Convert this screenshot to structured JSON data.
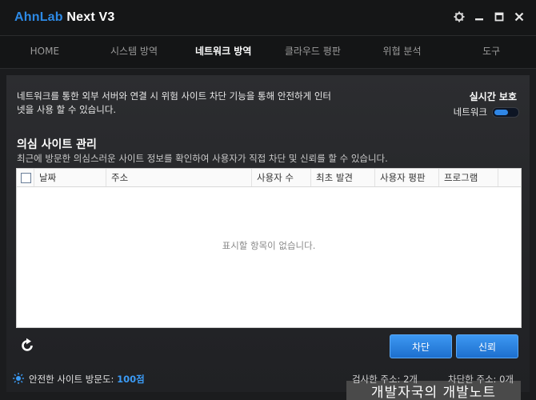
{
  "window": {
    "title_brand": "AhnLab",
    "title_product": " Next V3",
    "controls": {
      "settings": "gear-icon",
      "minimize": "minimize-icon",
      "maximize": "maximize-icon",
      "close": "close-icon"
    }
  },
  "nav": {
    "items": [
      {
        "label": "HOME",
        "active": false
      },
      {
        "label": "시스템 방역",
        "active": false
      },
      {
        "label": "네트워크 방역",
        "active": true
      },
      {
        "label": "클라우드 평판",
        "active": false
      },
      {
        "label": "위협 분석",
        "active": false
      },
      {
        "label": "도구",
        "active": false
      }
    ]
  },
  "intro": {
    "line1": "네트워크를 통한 외부 서버와 연결 시 위험 사이트 차단 기능을 통해 안전하게 인터",
    "line2": "넷을 사용 할 수 있습니다."
  },
  "realtime": {
    "title": "실시간 보호",
    "label": "네트워크",
    "enabled": true
  },
  "section": {
    "title": "의심 사이트 관리",
    "desc": "최근에 방문한 의심스러운 사이트 정보를 확인하여 사용자가 직접 차단 및 신뢰를 할 수 있습니다."
  },
  "table": {
    "columns": [
      "날짜",
      "주소",
      "사용자 수",
      "최초 발견",
      "사용자 평판",
      "프로그램"
    ],
    "rows": [],
    "empty_text": "표시할 항목이 없습니다."
  },
  "watermark": "개발자국의 개발노트",
  "buttons": {
    "refresh": "refresh-icon",
    "block": "차단",
    "trust": "신뢰"
  },
  "status": {
    "visit_label": "안전한 사이트 방문도: ",
    "visit_score": "100점",
    "inspected": "검사한 주소: 2개",
    "blocked": "차단한 주소: 0개"
  },
  "colors": {
    "accent": "#2d8ae6",
    "score": "#3b9bf5",
    "background": "#1b1c1e"
  }
}
